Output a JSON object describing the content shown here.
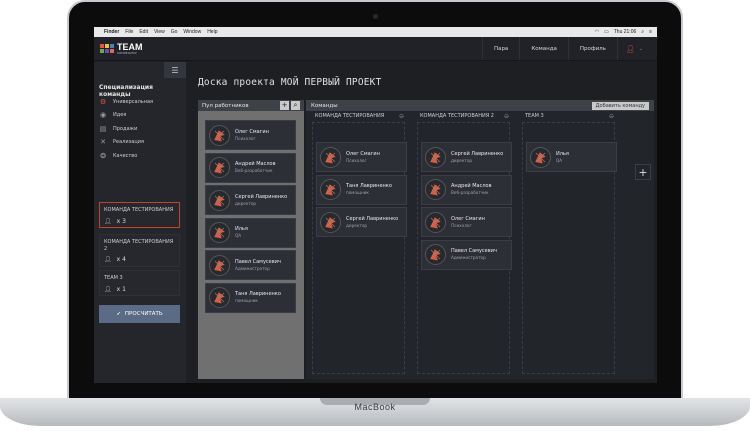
{
  "device_label": "MacBook",
  "menubar": {
    "items": [
      "Finder",
      "File",
      "Edit",
      "View",
      "Go",
      "Window",
      "Help"
    ],
    "clock": "Thu 21:06"
  },
  "app": {
    "logo_text": "TEAM",
    "logo_sub": "constructor",
    "nav": [
      "Пара",
      "Команда",
      "Профиль"
    ]
  },
  "sidebar": {
    "title": "Специализация команды",
    "specializations": [
      {
        "label": "Универсальная",
        "icon": "gear-icon"
      },
      {
        "label": "Идея",
        "icon": "bulb-icon"
      },
      {
        "label": "Продажи",
        "icon": "cart-icon"
      },
      {
        "label": "Реализация",
        "icon": "tools-icon"
      },
      {
        "label": "Качество",
        "icon": "medal-icon"
      }
    ],
    "teams": [
      {
        "name": "КОМАНДА ТЕСТИРОВАНИЯ",
        "count": "x 3"
      },
      {
        "name": "КОМАНДА ТЕСТИРОВАНИЯ 2",
        "count": "x 4"
      },
      {
        "name": "TEAM 3",
        "count": "x 1"
      }
    ],
    "calc_label": "ПРОСЧИТАТЬ"
  },
  "main": {
    "page_title": "Доска проекта МОЙ ПЕРВЫЙ ПРОЕКТ",
    "pool": {
      "title": "Пул работников",
      "add_symbol": "+",
      "workers": [
        {
          "name": "Олег Смагин",
          "role": "Психолог"
        },
        {
          "name": "Андрей Маслов",
          "role": "Веб-разработчик"
        },
        {
          "name": "Сергей Лавриненко",
          "role": "директор"
        },
        {
          "name": "Илья",
          "role": "QA"
        },
        {
          "name": "Павел Самусевич",
          "role": "Администратор"
        },
        {
          "name": "Таня Лавриненко",
          "role": "помощник"
        }
      ]
    },
    "teams": {
      "title": "Команды",
      "add_label": "Добавить команду",
      "plus_symbol": "+",
      "columns": [
        {
          "name": "КОМАНДА ТЕСТИРОВАНИЯ",
          "members": [
            {
              "name": "Олег Смагин",
              "role": "Психолог"
            },
            {
              "name": "Таня Лавриненко",
              "role": "помощник"
            },
            {
              "name": "Сергей Лавриненко",
              "role": "директор"
            }
          ]
        },
        {
          "name": "КОМАНДА ТЕСТИРОВАНИЯ 2",
          "members": [
            {
              "name": "Сергей Лавриненко",
              "role": "директор"
            },
            {
              "name": "Андрей Маслов",
              "role": "Веб-разработчик"
            },
            {
              "name": "Олег Смагин",
              "role": "Психолог"
            },
            {
              "name": "Павел Самусевич",
              "role": "Администратор"
            }
          ]
        },
        {
          "name": "TEAM 3",
          "members": [
            {
              "name": "Илья",
              "role": "QA"
            }
          ]
        }
      ]
    }
  },
  "colors": {
    "accent": "#e2573a",
    "button": "#5b6b86",
    "panel": "#22252a"
  }
}
